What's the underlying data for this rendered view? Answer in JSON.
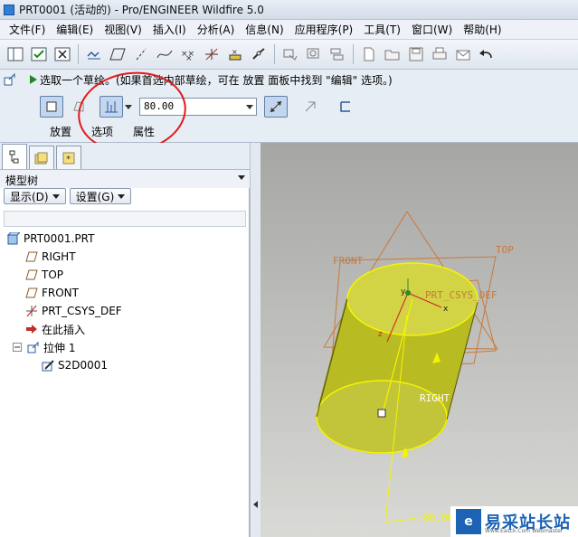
{
  "window": {
    "title": "PRT0001 (活动的) - Pro/ENGINEER Wildfire 5.0"
  },
  "menu": [
    "文件(F)",
    "编辑(E)",
    "视图(V)",
    "插入(I)",
    "分析(A)",
    "信息(N)",
    "应用程序(P)",
    "工具(T)",
    "窗口(W)",
    "帮助(H)"
  ],
  "prompt": {
    "text": "选取一个草绘。(如果首选内部草绘，可在 放置 面板中找到 \"编辑\" 选项。)"
  },
  "dashboard": {
    "depth_value": "80.00",
    "tabs": [
      "放置",
      "选项",
      "属性"
    ]
  },
  "model_tree": {
    "header": "模型树",
    "show_button": "显示(D)",
    "settings_button": "设置(G)",
    "items": [
      {
        "label": "PRT0001.PRT",
        "icon": "part-icon"
      },
      {
        "label": "RIGHT",
        "icon": "datum-plane-icon"
      },
      {
        "label": "TOP",
        "icon": "datum-plane-icon"
      },
      {
        "label": "FRONT",
        "icon": "datum-plane-icon"
      },
      {
        "label": "PRT_CSYS_DEF",
        "icon": "csys-icon"
      },
      {
        "label": "在此插入",
        "icon": "insert-here-arrow-icon"
      },
      {
        "label": "拉伸 1",
        "icon": "extrude-icon"
      },
      {
        "label": "S2D0001",
        "icon": "sketch-icon"
      }
    ]
  },
  "viewport": {
    "labels": {
      "front": "FRONT",
      "top": "TOP",
      "csys": "PRT_CSYS_DEF",
      "right": "RIGHT",
      "dimension": "80.00"
    },
    "csys_axes": {
      "x": "x",
      "y": "y",
      "z": "z"
    }
  },
  "watermark": {
    "text": "易采站长站",
    "sub": "Www.Easck.Com  Webmaster"
  },
  "colors": {
    "annotation": "#e01a1a",
    "datum": "#c87a3c",
    "extrude_fill": "#bdbf2a",
    "highlight": "#f5f500"
  }
}
